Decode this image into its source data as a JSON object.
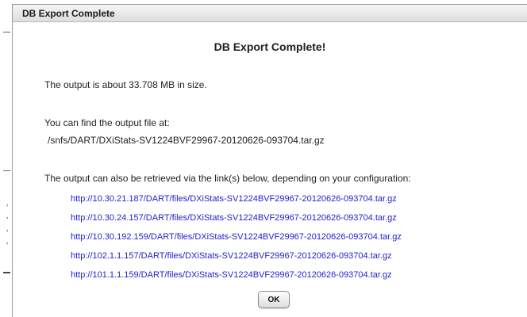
{
  "dialog": {
    "title": "DB Export Complete",
    "heading": "DB Export Complete!",
    "size_text": "The output is about 33.708 MB in size.",
    "location_label": "You can find the output file at:",
    "file_path": "/snfs/DART/DXiStats-SV1224BVF29967-20120626-093704.tar.gz",
    "links_intro": "The output can also be retrieved via the link(s) below, depending on your configuration:",
    "links": [
      "http://10.30.21.187/DART/files/DXiStats-SV1224BVF29967-20120626-093704.tar.gz",
      "http://10.30.24.157/DART/files/DXiStats-SV1224BVF29967-20120626-093704.tar.gz",
      "http://10.30.192.159/DART/files/DXiStats-SV1224BVF29967-20120626-093704.tar.gz",
      "http://102.1.1.157/DART/files/DXiStats-SV1224BVF29967-20120626-093704.tar.gz",
      "http://101.1.1.159/DART/files/DXiStats-SV1224BVF29967-20120626-093704.tar.gz"
    ],
    "ok_label": "OK"
  },
  "colors": {
    "link": "#1f1fcc",
    "title_bar": "#e6e6e6",
    "text": "#222222"
  }
}
